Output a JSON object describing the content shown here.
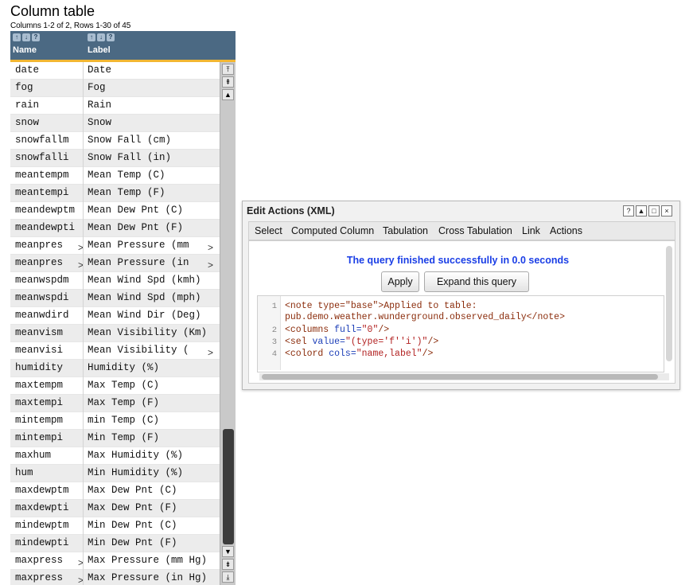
{
  "column_table": {
    "title": "Column table",
    "summary": "Columns 1-2 of 2,  Rows 1-30 of 45",
    "headers": {
      "name": "Name",
      "label": "Label"
    },
    "rows": [
      {
        "name": "date",
        "label": "Date"
      },
      {
        "name": "fog",
        "label": "Fog"
      },
      {
        "name": "rain",
        "label": "Rain"
      },
      {
        "name": "snow",
        "label": "Snow"
      },
      {
        "name": "snowfallm",
        "label": "Snow Fall (cm)"
      },
      {
        "name": "snowfalli",
        "label": "Snow Fall (in)"
      },
      {
        "name": "meantempm",
        "label": "Mean Temp (C)"
      },
      {
        "name": "meantempi",
        "label": "Mean Temp (F)"
      },
      {
        "name": "meandewptm",
        "label": "Mean Dew Pnt (C)"
      },
      {
        "name": "meandewpti",
        "label": "Mean Dew Pnt (F)"
      },
      {
        "name": "meanpres",
        "name_more": ">",
        "label": "Mean Pressure (mm",
        "label_more": ">"
      },
      {
        "name": "meanpres",
        "name_more": ">",
        "label": "Mean Pressure (in",
        "label_more": ">"
      },
      {
        "name": "meanwspdm",
        "label": "Mean Wind Spd (kmh)"
      },
      {
        "name": "meanwspdi",
        "label": "Mean Wind Spd (mph)"
      },
      {
        "name": "meanwdird",
        "label": "Mean Wind Dir (Deg)"
      },
      {
        "name": "meanvism",
        "label": "Mean Visibility (Km)"
      },
      {
        "name": "meanvisi",
        "label": "Mean Visibility (",
        "label_more": ">"
      },
      {
        "name": "humidity",
        "label": "Humidity (%)"
      },
      {
        "name": "maxtempm",
        "label": "Max Temp (C)"
      },
      {
        "name": "maxtempi",
        "label": "Max Temp (F)"
      },
      {
        "name": "mintempm",
        "label": "min Temp (C)"
      },
      {
        "name": "mintempi",
        "label": "Min Temp (F)"
      },
      {
        "name": "maxhum",
        "label": "Max Humidity (%)"
      },
      {
        "name": "hum",
        "label": "Min Humidity (%)"
      },
      {
        "name": "maxdewptm",
        "label": "Max Dew Pnt (C)"
      },
      {
        "name": "maxdewpti",
        "label": "Max Dew Pnt (F)"
      },
      {
        "name": "mindewptm",
        "label": "Min Dew Pnt (C)"
      },
      {
        "name": "mindewpti",
        "label": "Min Dew Pnt (F)"
      },
      {
        "name": "maxpress",
        "name_more": ">",
        "label": "Max Pressure (mm Hg)"
      },
      {
        "name": "maxpress",
        "name_more": ">",
        "label": "Max Pressure (in Hg)"
      }
    ]
  },
  "edit_panel": {
    "title": "Edit Actions (XML)",
    "window_buttons": [
      "?",
      "▲",
      "□",
      "×"
    ],
    "menu": [
      "Select",
      "Computed Column",
      "Tabulation",
      "Cross Tabulation",
      "Link",
      "Actions"
    ],
    "status": "The query finished successfully in 0.0 seconds",
    "apply_label": "Apply",
    "expand_label": "Expand this query",
    "code": {
      "line_numbers": [
        "1",
        "2",
        "3",
        "4"
      ],
      "l1_open": "<note type=\"base\">",
      "l1_text": "Applied to table:",
      "l1b_text": "pub.demo.weather.wunderground.observed_daily",
      "l1b_close": "</note>",
      "l2_tag": "<columns ",
      "l2_attr": "full=",
      "l2_val": "\"0\"",
      "l2_end": "/>",
      "l3_tag": "<sel ",
      "l3_attr": "value=",
      "l3_val": "\"(type='f''i')\"",
      "l3_end": "/>",
      "l4_tag": "<colord ",
      "l4_attr": "cols=",
      "l4_val": "\"name,label\"",
      "l4_end": "/>"
    }
  }
}
